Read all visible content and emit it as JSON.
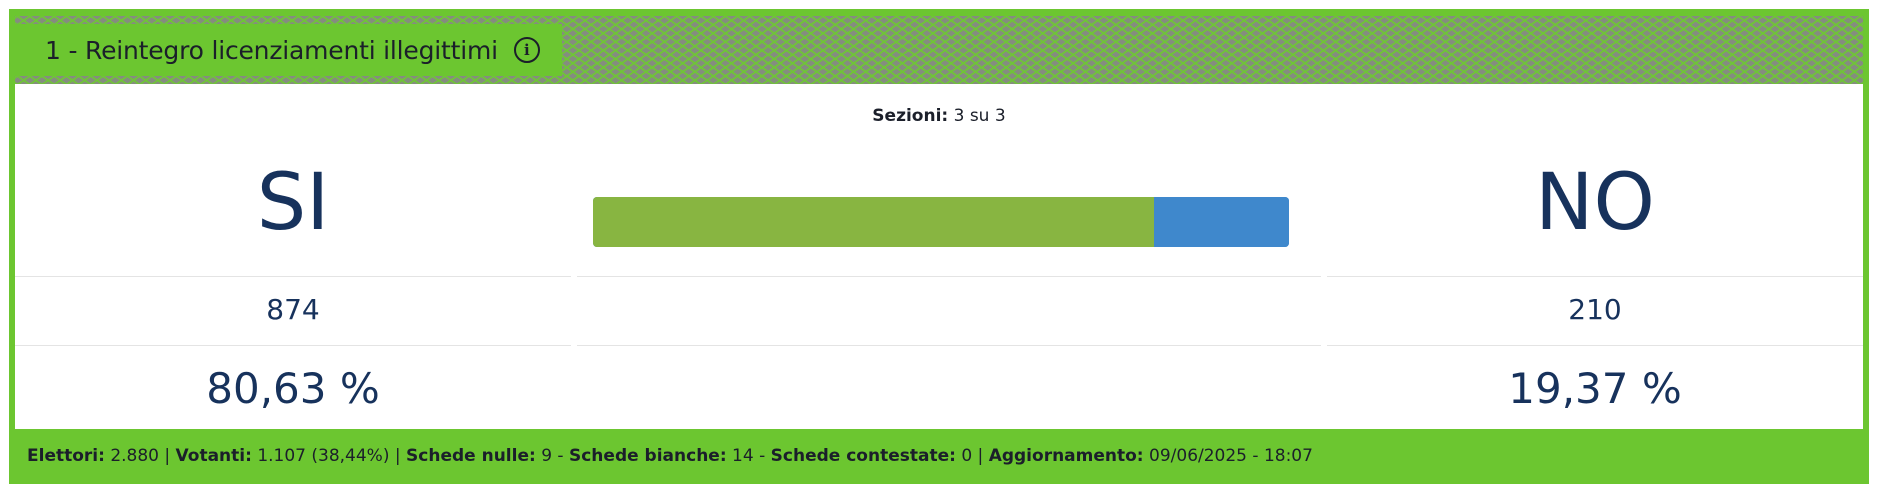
{
  "header": {
    "title": "1 - Reintegro licenziamenti illegittimi",
    "info_icon": "info-circle-icon"
  },
  "sections": {
    "label": "Sezioni:",
    "value": "3 su 3"
  },
  "results": {
    "yes": {
      "label": "SI",
      "votes": "874",
      "percent": "80,63 %"
    },
    "no": {
      "label": "NO",
      "votes": "210",
      "percent": "19,37 %"
    },
    "bar_yes_fraction": 0.8063
  },
  "footer": {
    "electors_label": "Elettori:",
    "electors_value": "2.880",
    "voters_label": "Votanti:",
    "voters_value": "1.107 (38,44%)",
    "null_label": "Schede nulle:",
    "null_value": "9",
    "blank_label": "Schede bianche:",
    "blank_value": "14",
    "contested_label": "Schede contestate:",
    "contested_value": "0",
    "updated_label": "Aggiornamento:",
    "updated_value": "09/06/2025 - 18:07"
  },
  "colors": {
    "brand_green": "#6cc630",
    "yes_bar": "#88b541",
    "no_bar": "#3f88cc",
    "result_text": "#17325c"
  }
}
